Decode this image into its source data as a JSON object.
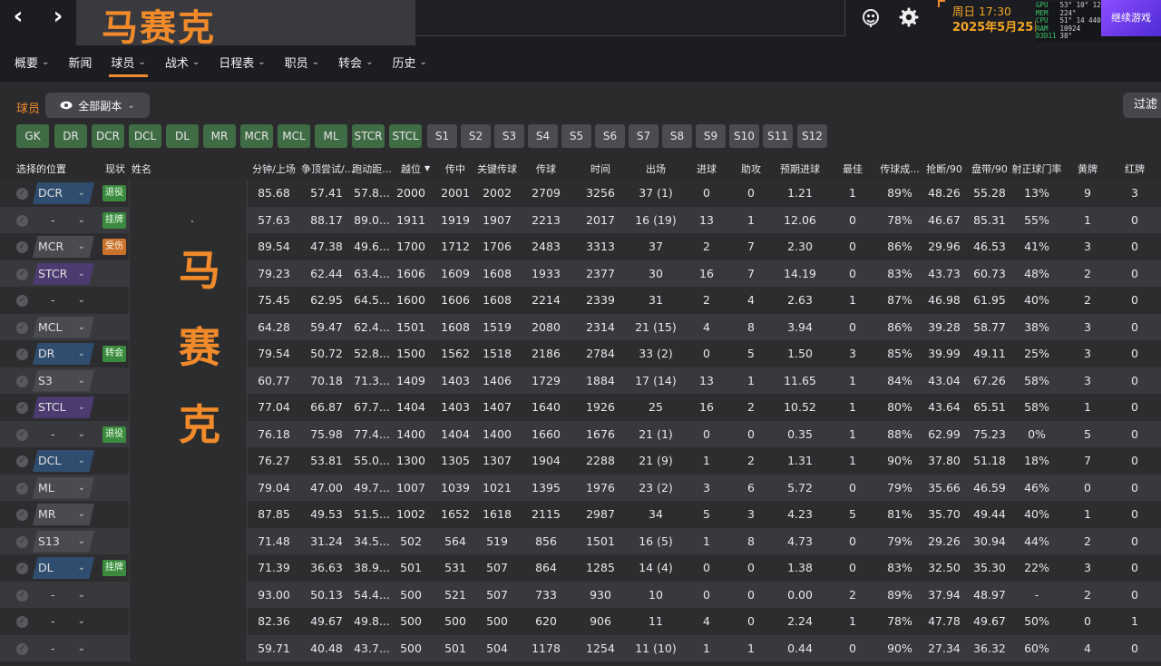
{
  "window": {
    "club_title": "马赛克",
    "date_line1": "周日 17:30",
    "date_line2": "2025年5月25日",
    "continue_label": "继续游戏"
  },
  "hud": [
    {
      "label": "GPU",
      "v1": "53°",
      "v2": "10°",
      "v3": "12°"
    },
    {
      "label": "MEM",
      "v1": "224°",
      "v2": "",
      "v3": ""
    },
    {
      "label": "CPU",
      "v1": "51°",
      "v2": "14",
      "v3": "4400"
    },
    {
      "label": "RAM",
      "v1": "10924",
      "v2": "",
      "v3": ""
    },
    {
      "label": "D3D11",
      "v1": "38°",
      "v2": "",
      "v3": ""
    }
  ],
  "menu": [
    {
      "label": "概要",
      "chev": true
    },
    {
      "label": "新闻",
      "chev": false
    },
    {
      "label": "球员",
      "chev": true,
      "active": true
    },
    {
      "label": "战术",
      "chev": true
    },
    {
      "label": "日程表",
      "chev": true
    },
    {
      "label": "职员",
      "chev": true
    },
    {
      "label": "转会",
      "chev": true
    },
    {
      "label": "历史",
      "chev": true
    }
  ],
  "filters": {
    "section_label": "球员",
    "view_label": "全部副本",
    "filter_label": "过滤"
  },
  "chips": [
    {
      "label": "GK",
      "kind": "green"
    },
    {
      "label": "DR",
      "kind": "green"
    },
    {
      "label": "DCR",
      "kind": "green"
    },
    {
      "label": "DCL",
      "kind": "green"
    },
    {
      "label": "DL",
      "kind": "green"
    },
    {
      "label": "MR",
      "kind": "green"
    },
    {
      "label": "MCR",
      "kind": "green"
    },
    {
      "label": "MCL",
      "kind": "green"
    },
    {
      "label": "ML",
      "kind": "green"
    },
    {
      "label": "STCR",
      "kind": "green"
    },
    {
      "label": "STCL",
      "kind": "green"
    },
    {
      "label": "S1",
      "kind": "grey"
    },
    {
      "label": "S2",
      "kind": "grey"
    },
    {
      "label": "S3",
      "kind": "grey"
    },
    {
      "label": "S4",
      "kind": "grey"
    },
    {
      "label": "S5",
      "kind": "grey"
    },
    {
      "label": "S6",
      "kind": "grey"
    },
    {
      "label": "S7",
      "kind": "grey"
    },
    {
      "label": "S8",
      "kind": "grey"
    },
    {
      "label": "S9",
      "kind": "grey"
    },
    {
      "label": "S10",
      "kind": "grey"
    },
    {
      "label": "S11",
      "kind": "grey"
    },
    {
      "label": "S12",
      "kind": "grey"
    }
  ],
  "columns": {
    "position": "选择的位置",
    "status": "现状",
    "name": "姓名",
    "stats": [
      "分钟/上场",
      "争顶尝试/...",
      "跑动距...",
      "越位",
      "传中",
      "关键传球",
      "传球",
      "时间",
      "出场",
      "进球",
      "助攻",
      "预期进球",
      "最佳",
      "传球成...",
      "抢断/90",
      "盘带/90",
      "射正球门率",
      "黄牌",
      "红牌"
    ]
  },
  "name_overlay": [
    "马",
    "赛",
    "克"
  ],
  "rows": [
    {
      "pos": "DCR",
      "pos_kind": "def",
      "status": "退役",
      "status_kind": "green",
      "stats": [
        "85.68",
        "57.41",
        "57.8...",
        "2000",
        "2001",
        "2002",
        "2709",
        "3256",
        "37 (1)",
        "0",
        "0",
        "1.21",
        "1",
        "89%",
        "48.26",
        "55.28",
        "13%",
        "9",
        "3"
      ]
    },
    {
      "pos": "-",
      "pos_kind": "none",
      "status": "挂牌",
      "status_kind": "green",
      "stats": [
        "57.63",
        "88.17",
        "89.0...",
        "1911",
        "1919",
        "1907",
        "2213",
        "2017",
        "16 (19)",
        "13",
        "1",
        "12.06",
        "0",
        "78%",
        "46.67",
        "85.31",
        "55%",
        "1",
        "0"
      ]
    },
    {
      "pos": "MCR",
      "pos_kind": "mid",
      "status": "受伤",
      "status_kind": "injury",
      "stats": [
        "89.54",
        "47.38",
        "49.6...",
        "1700",
        "1712",
        "1706",
        "2483",
        "3313",
        "37",
        "2",
        "7",
        "2.30",
        "0",
        "86%",
        "29.96",
        "46.53",
        "41%",
        "3",
        "0"
      ]
    },
    {
      "pos": "STCR",
      "pos_kind": "att",
      "status": "",
      "status_kind": "",
      "stats": [
        "79.23",
        "62.44",
        "63.4...",
        "1606",
        "1609",
        "1608",
        "1933",
        "2377",
        "30",
        "16",
        "7",
        "14.19",
        "0",
        "83%",
        "43.73",
        "60.73",
        "48%",
        "2",
        "0"
      ]
    },
    {
      "pos": "-",
      "pos_kind": "none",
      "status": "",
      "status_kind": "",
      "stats": [
        "75.45",
        "62.95",
        "64.5...",
        "1600",
        "1606",
        "1608",
        "2214",
        "2339",
        "31",
        "2",
        "4",
        "2.63",
        "1",
        "87%",
        "46.98",
        "61.95",
        "40%",
        "2",
        "0"
      ]
    },
    {
      "pos": "MCL",
      "pos_kind": "mid",
      "status": "",
      "status_kind": "",
      "stats": [
        "64.28",
        "59.47",
        "62.4...",
        "1501",
        "1608",
        "1519",
        "2080",
        "2314",
        "21 (15)",
        "4",
        "8",
        "3.94",
        "0",
        "86%",
        "39.28",
        "58.77",
        "38%",
        "3",
        "0"
      ]
    },
    {
      "pos": "DR",
      "pos_kind": "def",
      "status": "转会",
      "status_kind": "green",
      "stats": [
        "79.54",
        "50.72",
        "52.8...",
        "1500",
        "1562",
        "1518",
        "2186",
        "2784",
        "33 (2)",
        "0",
        "5",
        "1.50",
        "3",
        "85%",
        "39.99",
        "49.11",
        "25%",
        "3",
        "0"
      ]
    },
    {
      "pos": "S3",
      "pos_kind": "mid",
      "status": "",
      "status_kind": "",
      "stats": [
        "60.77",
        "70.18",
        "71.3...",
        "1409",
        "1403",
        "1406",
        "1729",
        "1884",
        "17 (14)",
        "13",
        "1",
        "11.65",
        "1",
        "84%",
        "43.04",
        "67.26",
        "58%",
        "3",
        "0"
      ]
    },
    {
      "pos": "STCL",
      "pos_kind": "att",
      "status": "",
      "status_kind": "",
      "stats": [
        "77.04",
        "66.87",
        "67.7...",
        "1404",
        "1403",
        "1407",
        "1640",
        "1926",
        "25",
        "16",
        "2",
        "10.52",
        "1",
        "80%",
        "43.64",
        "65.51",
        "58%",
        "1",
        "0"
      ]
    },
    {
      "pos": "-",
      "pos_kind": "none",
      "status": "退役",
      "status_kind": "green",
      "stats": [
        "76.18",
        "75.98",
        "77.4...",
        "1400",
        "1404",
        "1400",
        "1660",
        "1676",
        "21 (1)",
        "0",
        "0",
        "0.35",
        "1",
        "88%",
        "62.99",
        "75.23",
        "0%",
        "5",
        "0"
      ]
    },
    {
      "pos": "DCL",
      "pos_kind": "def",
      "status": "",
      "status_kind": "",
      "stats": [
        "76.27",
        "53.81",
        "55.0...",
        "1300",
        "1305",
        "1307",
        "1904",
        "2288",
        "21 (9)",
        "1",
        "2",
        "1.31",
        "1",
        "90%",
        "37.80",
        "51.18",
        "18%",
        "7",
        "0"
      ]
    },
    {
      "pos": "ML",
      "pos_kind": "mid",
      "status": "",
      "status_kind": "",
      "stats": [
        "79.04",
        "47.00",
        "49.7...",
        "1007",
        "1039",
        "1021",
        "1395",
        "1976",
        "23 (2)",
        "3",
        "6",
        "5.72",
        "0",
        "79%",
        "35.66",
        "46.59",
        "46%",
        "0",
        "0"
      ]
    },
    {
      "pos": "MR",
      "pos_kind": "mid",
      "status": "",
      "status_kind": "",
      "stats": [
        "87.85",
        "49.53",
        "51.5...",
        "1002",
        "1652",
        "1618",
        "2115",
        "2987",
        "34",
        "5",
        "3",
        "4.23",
        "5",
        "81%",
        "35.70",
        "49.44",
        "40%",
        "1",
        "0"
      ]
    },
    {
      "pos": "S13",
      "pos_kind": "mid",
      "status": "",
      "status_kind": "",
      "stats": [
        "71.48",
        "31.24",
        "34.5...",
        "502",
        "564",
        "519",
        "856",
        "1501",
        "16 (5)",
        "1",
        "8",
        "4.73",
        "0",
        "79%",
        "29.26",
        "30.94",
        "44%",
        "2",
        "0"
      ]
    },
    {
      "pos": "DL",
      "pos_kind": "def",
      "status": "挂牌",
      "status_kind": "green",
      "stats": [
        "71.39",
        "36.63",
        "38.9...",
        "501",
        "531",
        "507",
        "864",
        "1285",
        "14 (4)",
        "0",
        "0",
        "1.38",
        "0",
        "83%",
        "32.50",
        "35.30",
        "22%",
        "3",
        "0"
      ]
    },
    {
      "pos": "-",
      "pos_kind": "none",
      "status": "",
      "status_kind": "",
      "stats": [
        "93.00",
        "50.13",
        "54.4...",
        "500",
        "521",
        "507",
        "733",
        "930",
        "10",
        "0",
        "0",
        "0.00",
        "2",
        "89%",
        "37.94",
        "48.97",
        "-",
        "2",
        "0"
      ]
    },
    {
      "pos": "-",
      "pos_kind": "none",
      "status": "",
      "status_kind": "",
      "stats": [
        "82.36",
        "49.67",
        "49.8...",
        "500",
        "500",
        "500",
        "620",
        "906",
        "11",
        "4",
        "0",
        "2.24",
        "1",
        "78%",
        "47.78",
        "49.67",
        "50%",
        "0",
        "1"
      ]
    },
    {
      "pos": "-",
      "pos_kind": "none",
      "status": "",
      "status_kind": "",
      "stats": [
        "59.71",
        "40.48",
        "43.7...",
        "500",
        "501",
        "504",
        "1178",
        "1254",
        "11 (10)",
        "1",
        "1",
        "0.44",
        "0",
        "90%",
        "27.34",
        "36.32",
        "60%",
        "4",
        "0"
      ]
    }
  ]
}
